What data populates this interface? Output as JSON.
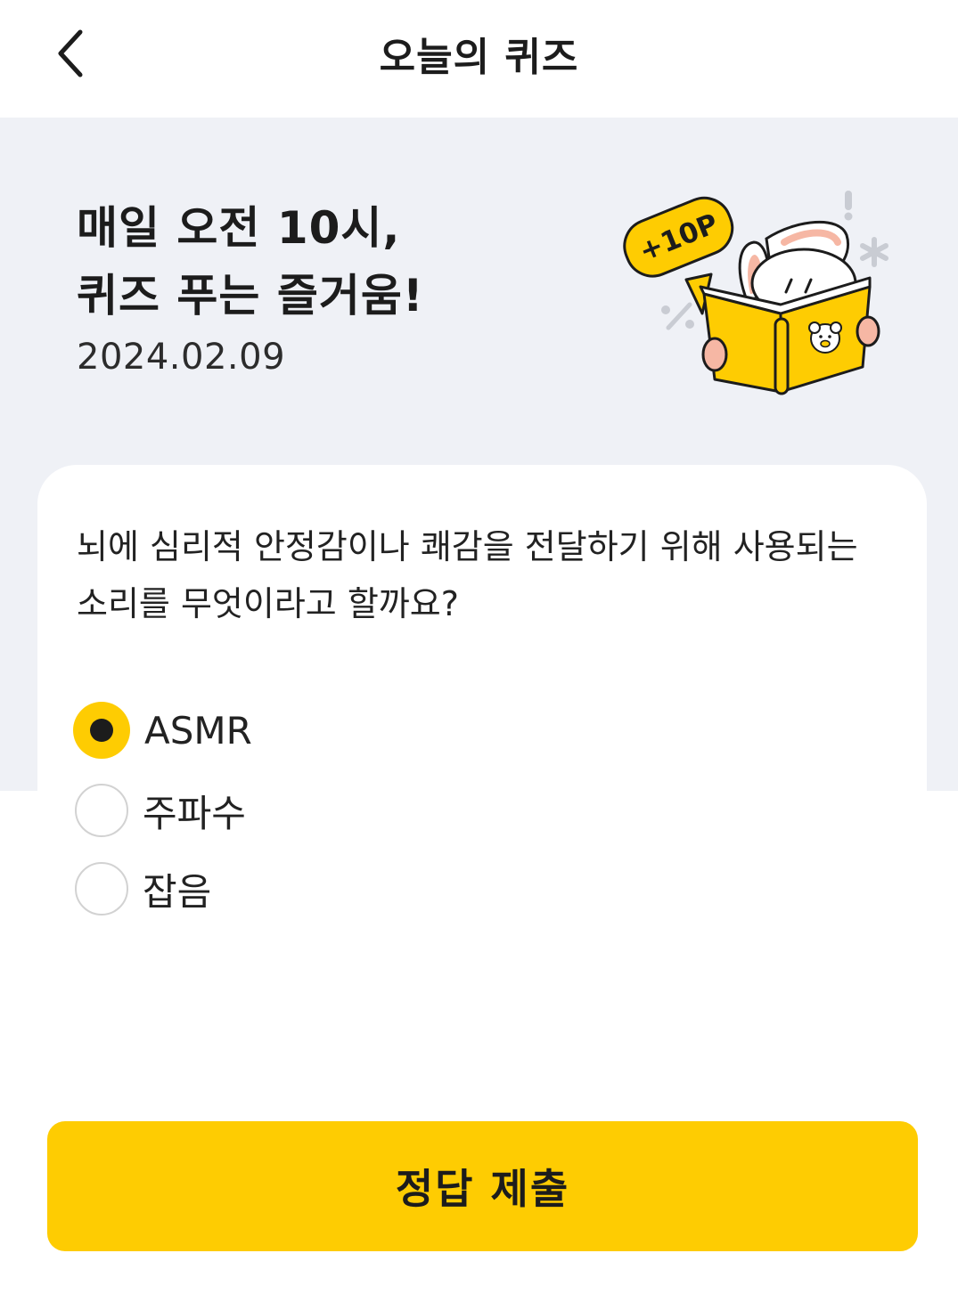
{
  "header": {
    "title": "오늘의 퀴즈",
    "back_icon": "chevron-left-icon"
  },
  "hero": {
    "headline_line1": "매일 오전 10시,",
    "headline_line2": "퀴즈 푸는 즐거움!",
    "date": "2024.02.09",
    "badge_text": "+10P"
  },
  "quiz": {
    "question": "뇌에 심리적 안정감이나 쾌감을 전달하기 위해 사용되는 소리를 무엇이라고 할까요?",
    "options": [
      {
        "label": "ASMR",
        "selected": true
      },
      {
        "label": "주파수",
        "selected": false
      },
      {
        "label": "잡음",
        "selected": false
      }
    ]
  },
  "submit_label": "정답 제출",
  "colors": {
    "accent": "#fecc02",
    "hero_background": "#eff1f6",
    "text": "#1c1c1c"
  }
}
